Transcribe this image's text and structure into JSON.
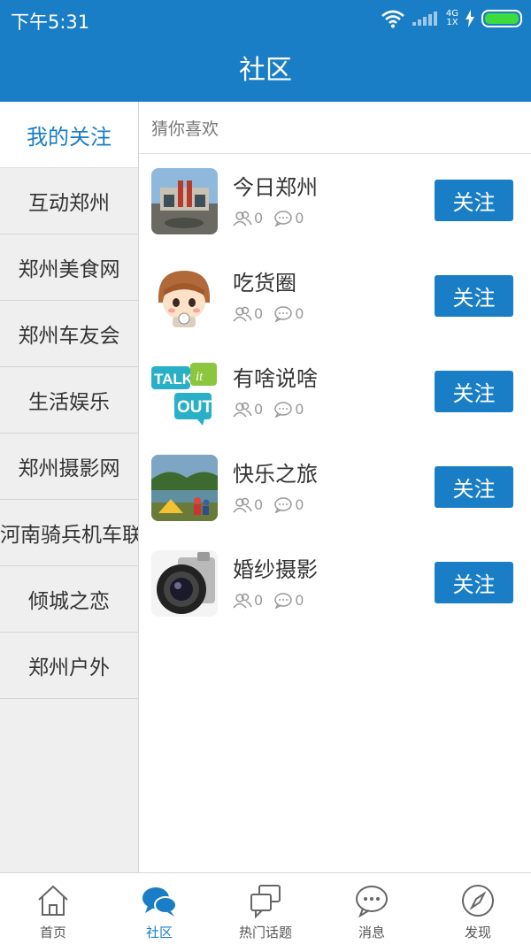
{
  "status": {
    "time": "下午5:31",
    "network": "4G",
    "network2": "1X"
  },
  "header": {
    "title": "社区"
  },
  "sidebar": {
    "selected": "我的关注",
    "items": [
      {
        "label": "互动郑州"
      },
      {
        "label": "郑州美食网"
      },
      {
        "label": "郑州车友会"
      },
      {
        "label": "生活娱乐"
      },
      {
        "label": "郑州摄影网"
      },
      {
        "label": "河南骑兵机车联"
      },
      {
        "label": "倾城之恋"
      },
      {
        "label": "郑州户外"
      }
    ]
  },
  "main": {
    "section_label": "猜你喜欢",
    "follow_label": "关注",
    "communities": [
      {
        "name": "今日郑州",
        "members": "0",
        "comments": "0"
      },
      {
        "name": "吃货圈",
        "members": "0",
        "comments": "0"
      },
      {
        "name": "有啥说啥",
        "members": "0",
        "comments": "0"
      },
      {
        "name": "快乐之旅",
        "members": "0",
        "comments": "0"
      },
      {
        "name": "婚纱摄影",
        "members": "0",
        "comments": "0"
      }
    ]
  },
  "tabbar": {
    "active_color": "#1a7ec6",
    "tabs": [
      {
        "label": "首页",
        "icon": "home-icon"
      },
      {
        "label": "社区",
        "icon": "community-icon"
      },
      {
        "label": "热门话题",
        "icon": "topics-icon"
      },
      {
        "label": "消息",
        "icon": "message-icon"
      },
      {
        "label": "发现",
        "icon": "compass-icon"
      }
    ]
  },
  "colors": {
    "brand": "#1a7ec6",
    "sidebar_bg": "#efefef",
    "battery": "#3ddc3d"
  }
}
